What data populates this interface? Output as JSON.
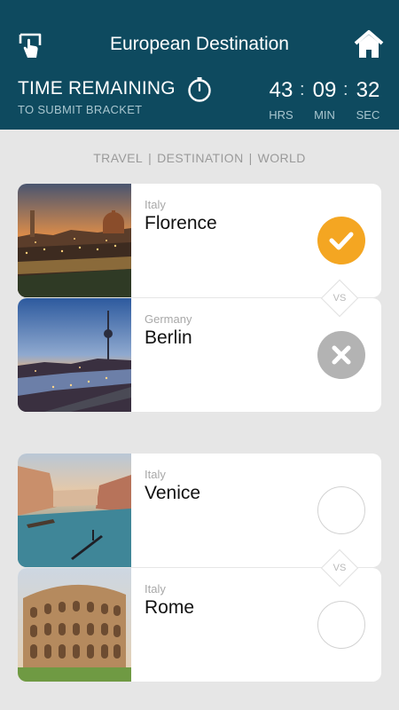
{
  "header": {
    "title": "European Destination",
    "back_icon": "touch-back-icon",
    "home_icon": "home-icon"
  },
  "timer": {
    "title": "TIME REMAINING",
    "subtitle": "TO SUBMIT BRACKET",
    "icon": "stopwatch-icon",
    "hours": "43",
    "minutes": "09",
    "seconds": "32",
    "hours_label": "HRS",
    "minutes_label": "MIN",
    "seconds_label": "SEC"
  },
  "breadcrumb": [
    "TRAVEL",
    "DESTINATION",
    "WORLD"
  ],
  "vs_label": "VS",
  "matchups": [
    {
      "a": {
        "country": "Italy",
        "city": "Florence",
        "status": "selected",
        "icon": "check-icon"
      },
      "b": {
        "country": "Germany",
        "city": "Berlin",
        "status": "rejected",
        "icon": "cross-icon"
      }
    },
    {
      "a": {
        "country": "Italy",
        "city": "Venice",
        "status": "unselected",
        "icon": "empty-circle"
      },
      "b": {
        "country": "Italy",
        "city": "Rome",
        "status": "unselected",
        "icon": "empty-circle"
      }
    }
  ],
  "colors": {
    "header_bg": "#0e4a5f",
    "selected": "#f4a622",
    "rejected": "#b3b3b3",
    "page_bg": "#e6e6e6"
  }
}
